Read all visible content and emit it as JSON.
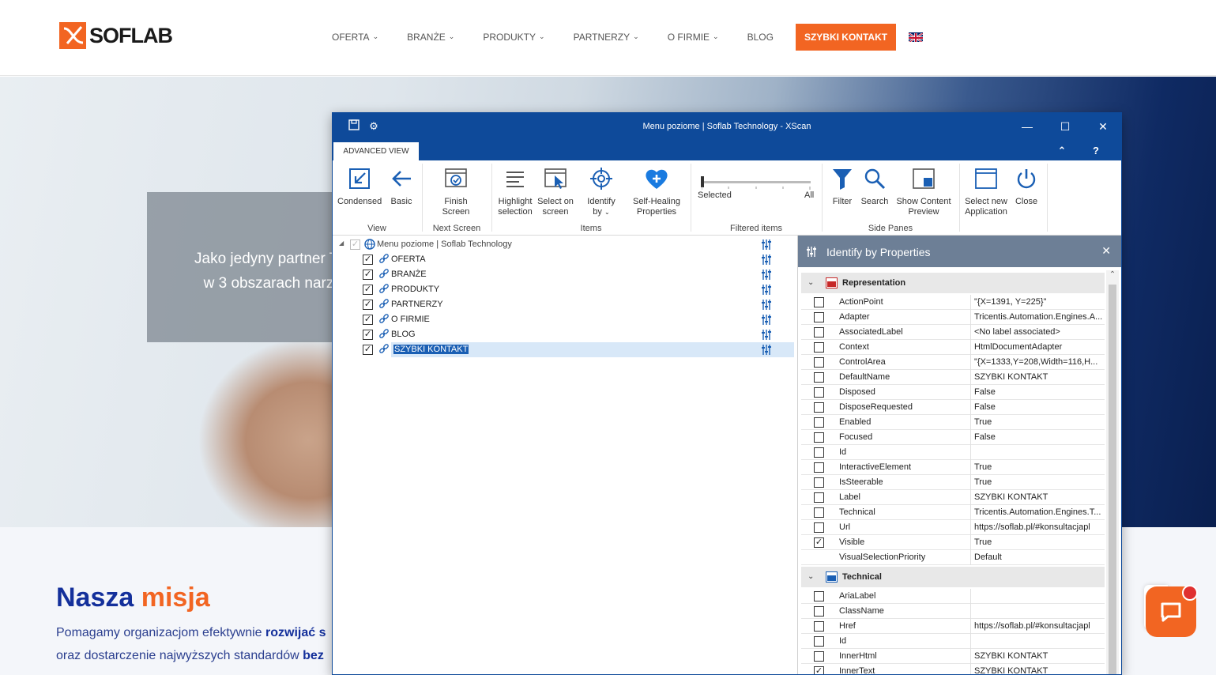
{
  "site": {
    "logo": "SOFLAB",
    "nav": [
      {
        "label": "OFERTA",
        "dropdown": true
      },
      {
        "label": "BRANŻE",
        "dropdown": true
      },
      {
        "label": "PRODUKTY",
        "dropdown": true
      },
      {
        "label": "PARTNERZY",
        "dropdown": true
      },
      {
        "label": "O FIRMIE",
        "dropdown": true
      },
      {
        "label": "BLOG",
        "dropdown": false
      }
    ],
    "cta": "SZYBKI KONTAKT",
    "hero_line1": "Jako jedyny partner Tr",
    "hero_line2": "w 3 obszarach narz",
    "mission_title_a": "Nasza",
    "mission_title_b": "misja",
    "mission_p1_a": "Pomagamy organizacjom efektywnie ",
    "mission_p1_b": "rozwijać s",
    "mission_p2_a": "oraz dostarczenie najwyższych standardów ",
    "mission_p2_b": "bez",
    "brand_color": "#f26522"
  },
  "xscan": {
    "title": "Menu poziome | Soflab Technology - XScan",
    "tab": "ADVANCED VIEW",
    "ribbon": {
      "condensed": "Condensed",
      "basic": "Basic",
      "group_view": "View",
      "finish_1": "Finish",
      "finish_2": "Screen",
      "group_next": "Next Screen",
      "highlight_1": "Highlight",
      "highlight_2": "selection",
      "select_1": "Select on",
      "select_2": "screen",
      "identify_1": "Identify",
      "identify_2": "by",
      "heal_1": "Self-Healing",
      "heal_2": "Properties",
      "group_items": "Items",
      "selected": "Selected",
      "all": "All",
      "group_filtered": "Filtered items",
      "filter": "Filter",
      "search": "Search",
      "content_1": "Show Content",
      "content_2": "Preview",
      "group_side": "Side Panes",
      "newapp_1": "Select new",
      "newapp_2": "Application",
      "close": "Close"
    },
    "tree": {
      "root": "Menu poziome | Soflab Technology",
      "items": [
        "OFERTA",
        "BRANŻE",
        "PRODUKTY",
        "PARTNERZY",
        "O FIRMIE",
        "BLOG",
        "SZYBKI KONTAKT"
      ]
    },
    "pane": {
      "title": "Identify by Properties",
      "representation": {
        "heading": "Representation",
        "rows": [
          {
            "name": "ActionPoint",
            "value": "\"{X=1391, Y=225}\"",
            "checked": false
          },
          {
            "name": "Adapter",
            "value": "Tricentis.Automation.Engines.A...",
            "checked": false
          },
          {
            "name": "AssociatedLabel",
            "value": "<No label associated>",
            "checked": false
          },
          {
            "name": "Context",
            "value": "HtmlDocumentAdapter",
            "checked": false
          },
          {
            "name": "ControlArea",
            "value": "\"{X=1333,Y=208,Width=116,H...",
            "checked": false
          },
          {
            "name": "DefaultName",
            "value": "SZYBKI KONTAKT",
            "checked": false
          },
          {
            "name": "Disposed",
            "value": "False",
            "checked": false
          },
          {
            "name": "DisposeRequested",
            "value": "False",
            "checked": false
          },
          {
            "name": "Enabled",
            "value": "True",
            "checked": false
          },
          {
            "name": "Focused",
            "value": "False",
            "checked": false
          },
          {
            "name": "Id",
            "value": "",
            "checked": false
          },
          {
            "name": "InteractiveElement",
            "value": "True",
            "checked": false
          },
          {
            "name": "IsSteerable",
            "value": "True",
            "checked": false
          },
          {
            "name": "Label",
            "value": "SZYBKI KONTAKT",
            "checked": false
          },
          {
            "name": "Technical",
            "value": "Tricentis.Automation.Engines.T...",
            "checked": false
          },
          {
            "name": "Url",
            "value": "https://soflab.pl/#konsultacjapl",
            "checked": false
          },
          {
            "name": "Visible",
            "value": "True",
            "checked": true
          },
          {
            "name": "VisualSelectionPriority",
            "value": "Default",
            "checked": null
          }
        ]
      },
      "technical": {
        "heading": "Technical",
        "rows": [
          {
            "name": "AriaLabel",
            "value": "",
            "checked": false
          },
          {
            "name": "ClassName",
            "value": "",
            "checked": false
          },
          {
            "name": "Href",
            "value": "https://soflab.pl/#konsultacjapl",
            "checked": false
          },
          {
            "name": "Id",
            "value": "",
            "checked": false
          },
          {
            "name": "InnerHtml",
            "value": "SZYBKI KONTAKT",
            "checked": false
          },
          {
            "name": "InnerText",
            "value": "SZYBKI KONTAKT",
            "checked": true
          }
        ]
      }
    }
  }
}
